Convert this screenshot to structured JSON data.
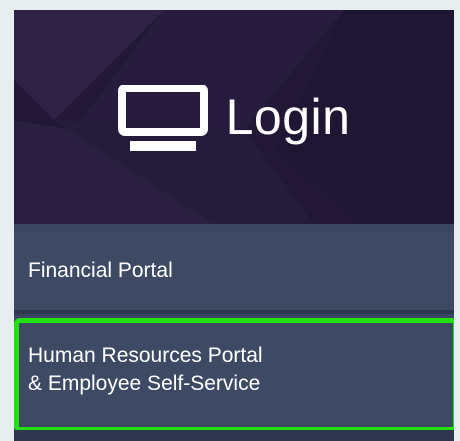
{
  "login": {
    "title": "Login",
    "icon": "monitor-icon"
  },
  "menu": {
    "items": [
      {
        "line1": "Financial Portal"
      },
      {
        "line1": "Human Resources Portal",
        "line2": "& Employee Self-Service"
      }
    ]
  },
  "colors": {
    "banner_bg": "#241a3a",
    "menu_bg": "#3e4a64",
    "highlight": "#22e011",
    "text": "#ffffff"
  }
}
